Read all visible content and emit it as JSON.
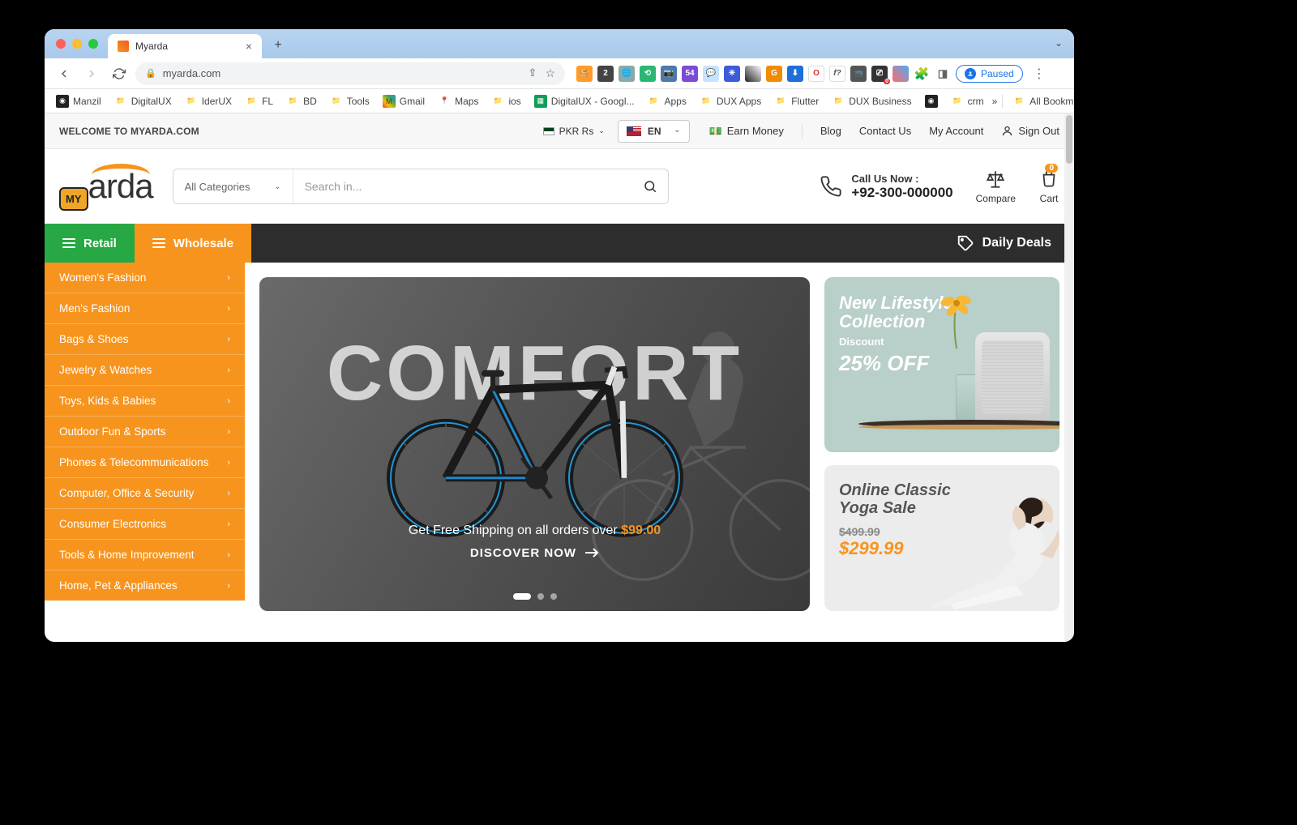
{
  "browser": {
    "tab_title": "Myarda",
    "url": "myarda.com",
    "paused_label": "Paused",
    "bookmarks": [
      "Manzil",
      "DigitalUX",
      "IderUX",
      "FL",
      "BD",
      "Tools",
      "Gmail",
      "Maps",
      "ios",
      "DigitalUX - Googl...",
      "Apps",
      "DUX Apps",
      "Flutter",
      "DUX Business",
      "crm"
    ],
    "bm_overflow": "»",
    "all_bookmarks": "All Bookmarks"
  },
  "topbar": {
    "welcome": "WELCOME TO MYARDA.COM",
    "currency": "PKR Rs",
    "language": "EN",
    "earn_money": "Earn Money",
    "links": [
      "Blog",
      "Contact Us",
      "My Account",
      "Sign Out"
    ]
  },
  "header": {
    "logo_my": "MY",
    "logo_arda": "arda",
    "category_label": "All Categories",
    "search_placeholder": "Search in...",
    "call_label": "Call Us Now :",
    "call_number": "+92-300-000000",
    "compare": "Compare",
    "cart": "Cart",
    "cart_count": "0"
  },
  "nav": {
    "retail": "Retail",
    "wholesale": "Wholesale",
    "daily_deals": "Daily Deals"
  },
  "sidebar": {
    "items": [
      "Women's Fashion",
      "Men's Fashion",
      "Bags & Shoes",
      "Jewelry & Watches",
      "Toys, Kids & Babies",
      "Outdoor Fun & Sports",
      "Phones & Telecommunications",
      "Computer, Office & Security",
      "Consumer Electronics",
      "Tools & Home Improvement",
      "Home, Pet & Appliances"
    ]
  },
  "hero": {
    "title": "COMFORT",
    "subtitle_pre": "Get Free Shipping on all orders over ",
    "subtitle_price": "$99.00",
    "cta": "DISCOVER NOW"
  },
  "promo1": {
    "line1": "New Lifestyle",
    "line2": "Collection",
    "discount_label": "Discount",
    "percent": "25% OFF"
  },
  "promo2": {
    "line1": "Online Classic",
    "line2": "Yoga Sale",
    "old_price": "$499.99",
    "new_price": "$299.99"
  }
}
